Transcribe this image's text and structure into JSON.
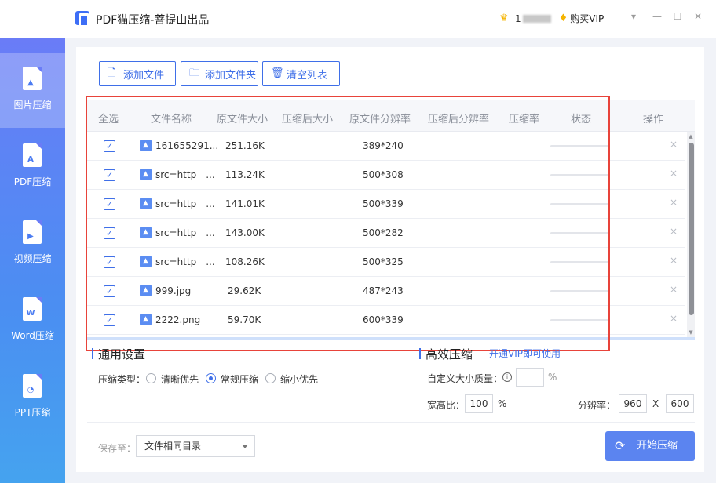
{
  "app": {
    "title": "PDF猫压缩-菩提山出品"
  },
  "user": {
    "name": "1",
    "vip_label": "购买VIP"
  },
  "window": {
    "minimize": "—",
    "maximize": "☐",
    "close": "✕",
    "menu": "▾"
  },
  "sidebar": {
    "items": [
      {
        "label": "图片压缩",
        "glyph": "▲",
        "active": true
      },
      {
        "label": "PDF压缩",
        "glyph": "A"
      },
      {
        "label": "视频压缩",
        "glyph": "▶"
      },
      {
        "label": "Word压缩",
        "glyph": "W"
      },
      {
        "label": "PPT压缩",
        "glyph": "◔"
      }
    ]
  },
  "toolbar": {
    "add_file": "添加文件",
    "add_folder": "添加文件夹",
    "clear_list": "清空列表"
  },
  "table": {
    "columns": [
      "全选",
      "文件名称",
      "原文件大小",
      "压缩后大小",
      "原文件分辨率",
      "压缩后分辨率",
      "压缩率",
      "状态",
      "操作"
    ],
    "rows": [
      {
        "name": "161655291...",
        "size": "251.16K",
        "resolution": "389*240"
      },
      {
        "name": "src=http__...",
        "size": "113.24K",
        "resolution": "500*308"
      },
      {
        "name": "src=http__...",
        "size": "141.01K",
        "resolution": "500*339"
      },
      {
        "name": "src=http__...",
        "size": "143.00K",
        "resolution": "500*282"
      },
      {
        "name": "src=http__...",
        "size": "108.26K",
        "resolution": "500*325"
      },
      {
        "name": "999.jpg",
        "size": "29.62K",
        "resolution": "487*243"
      },
      {
        "name": "2222.png",
        "size": "59.70K",
        "resolution": "600*339"
      }
    ],
    "check_mark": "✓",
    "delete_mark": "×"
  },
  "settings": {
    "general_title": "通用设置",
    "type_label": "压缩类型：",
    "options": [
      "清晰优先",
      "常规压缩",
      "缩小优先"
    ],
    "selected_option": "常规压缩",
    "efficient_title": "高效压缩",
    "vip_link": "开通VIP即可使用",
    "custom_size_label": "自定义大小质量：",
    "custom_size_value": "",
    "percent": "%",
    "ratio_label": "宽高比：",
    "ratio_value": "100",
    "resolution_label": "分辨率：",
    "res_w": "960",
    "res_x": "X",
    "res_h": "600"
  },
  "footer": {
    "save_label": "保存至：",
    "save_value": "文件相同目录",
    "start_label": "开始压缩"
  }
}
